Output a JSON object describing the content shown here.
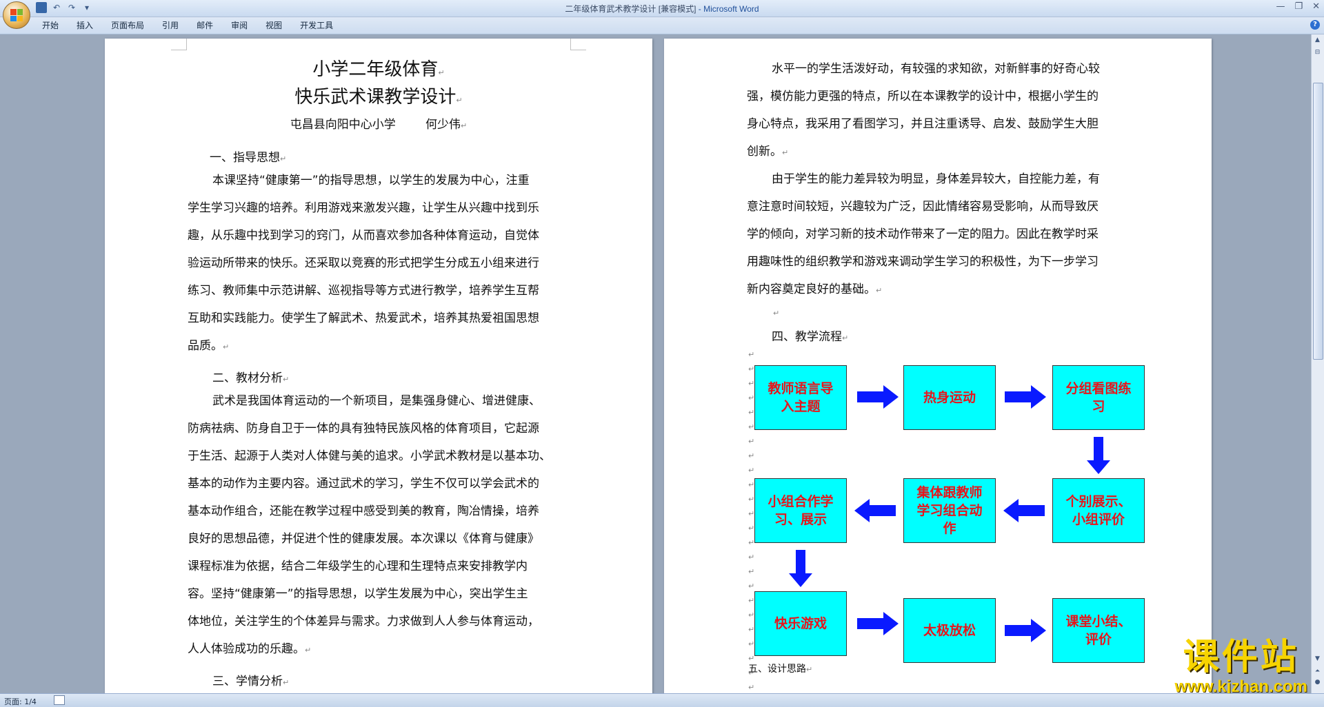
{
  "window": {
    "title": "二年级体育武术教学设计 [兼容模式]",
    "app_name": " - Microsoft Word"
  },
  "ribbon": {
    "tabs": [
      "开始",
      "插入",
      "页面布局",
      "引用",
      "邮件",
      "审阅",
      "视图",
      "开发工具"
    ]
  },
  "doc_left": {
    "title1": "小学二年级体育",
    "title2": "快乐武术课教学设计",
    "author": "屯昌县向阳中心小学        何少伟",
    "h1": "一、指导思想",
    "p1": [
      "本课坚持“健康第一”的指导思想，以学生的发展为中心，注重",
      "学生学习兴趣的培养。利用游戏来激发兴趣，让学生从兴趣中找到乐",
      "趣，从乐趣中找到学习的窍门，从而喜欢参加各种体育运动，自觉体",
      "验运动所带来的快乐。还采取以竞赛的形式把学生分成五小组来进行",
      "练习、教师集中示范讲解、巡视指导等方式进行教学，培养学生互帮",
      "互助和实践能力。使学生了解武术、热爱武术，培养其热爱祖国思想",
      "品质。"
    ],
    "h2": "二、教材分析",
    "p2": [
      "武术是我国体育运动的一个新项目，是集强身健心、增进健康、",
      "防病祛病、防身自卫于一体的具有独特民族风格的体育项目，它起源",
      "于生活、起源于人类对人体健与美的追求。小学武术教材是以基本功、",
      "基本的动作为主要内容。通过武术的学习，学生不仅可以学会武术的",
      "基本动作组合，还能在教学过程中感受到美的教育，陶冶情操，培养",
      "良好的思想品德，并促进个性的健康发展。本次课以《体育与健康》",
      "课程标准为依据，结合二年级学生的心理和生理特点来安排教学内",
      "容。坚持“健康第一”的指导思想，以学生发展为中心，突出学生主",
      "体地位，关注学生的个体差异与需求。力求做到人人参与体育运动，",
      "人人体验成功的乐趣。"
    ],
    "h3": "三、学情分析"
  },
  "doc_right": {
    "p1": [
      "水平一的学生活泼好动，有较强的求知欲，对新鲜事的好奇心较",
      "强，模仿能力更强的特点，所以在本课教学的设计中，根据小学生的",
      "身心特点，我采用了看图学习，并且注重诱导、启发、鼓励学生大胆",
      "创新。"
    ],
    "p2": [
      "由于学生的能力差异较为明显，身体差异较大，自控能力差，有",
      "意注意时间较短，兴趣较为广泛，因此情绪容易受影响，从而导致厌",
      "学的倾向，对学习新的技术动作带来了一定的阻力。因此在教学时采",
      "用趣味性的组织教学和游戏来调动学生学习的积极性，为下一步学习",
      "新内容奠定良好的基础。"
    ],
    "h4": "四、教学流程",
    "h5": "五、设计思路",
    "flow": [
      "教师语言导入主题",
      "热身运动",
      "分组看图练习",
      "个别展示、小组评价",
      "集体跟教师学习组合动作",
      "小组合作学习、展示",
      "快乐游戏",
      "太极放松",
      "课堂小结、评价"
    ]
  },
  "status": {
    "page": "页面: 1/4"
  },
  "watermark": {
    "line1": "课件站",
    "line2": "www.kjzhan.com"
  },
  "colors": {
    "flow_box": "#00ffff",
    "flow_text": "#e8141a",
    "arrow": "#0a1aff"
  }
}
